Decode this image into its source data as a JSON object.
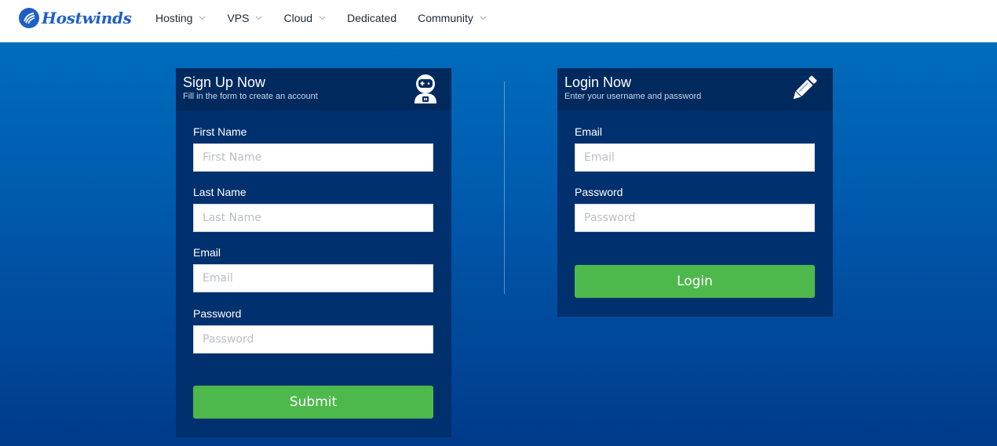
{
  "brand": {
    "name": "Hostwinds",
    "color": "#1f5fc4"
  },
  "nav": {
    "items": [
      {
        "label": "Hosting",
        "has_dropdown": true
      },
      {
        "label": "VPS",
        "has_dropdown": true
      },
      {
        "label": "Cloud",
        "has_dropdown": true
      },
      {
        "label": "Dedicated",
        "has_dropdown": false
      },
      {
        "label": "Community",
        "has_dropdown": true
      }
    ]
  },
  "signup": {
    "title": "Sign Up Now",
    "subtitle": "Fill in the form to create an account",
    "icon": "astronaut-icon",
    "fields": [
      {
        "label": "First Name",
        "placeholder": "First Name",
        "value": ""
      },
      {
        "label": "Last Name",
        "placeholder": "Last Name",
        "value": ""
      },
      {
        "label": "Email",
        "placeholder": "Email",
        "value": ""
      },
      {
        "label": "Password",
        "placeholder": "Password",
        "value": ""
      }
    ],
    "submit_label": "Submit"
  },
  "login": {
    "title": "Login Now",
    "subtitle": "Enter your username and password",
    "icon": "pencil-icon",
    "fields": [
      {
        "label": "Email",
        "placeholder": "Email",
        "value": ""
      },
      {
        "label": "Password",
        "placeholder": "Password",
        "value": ""
      }
    ],
    "submit_label": "Login"
  },
  "colors": {
    "panel_bg": "#00306d",
    "panel_header_bg": "#002a5e",
    "button_green": "#4db94c",
    "background_top": "#0071bf",
    "background_bottom": "#003a8a"
  }
}
